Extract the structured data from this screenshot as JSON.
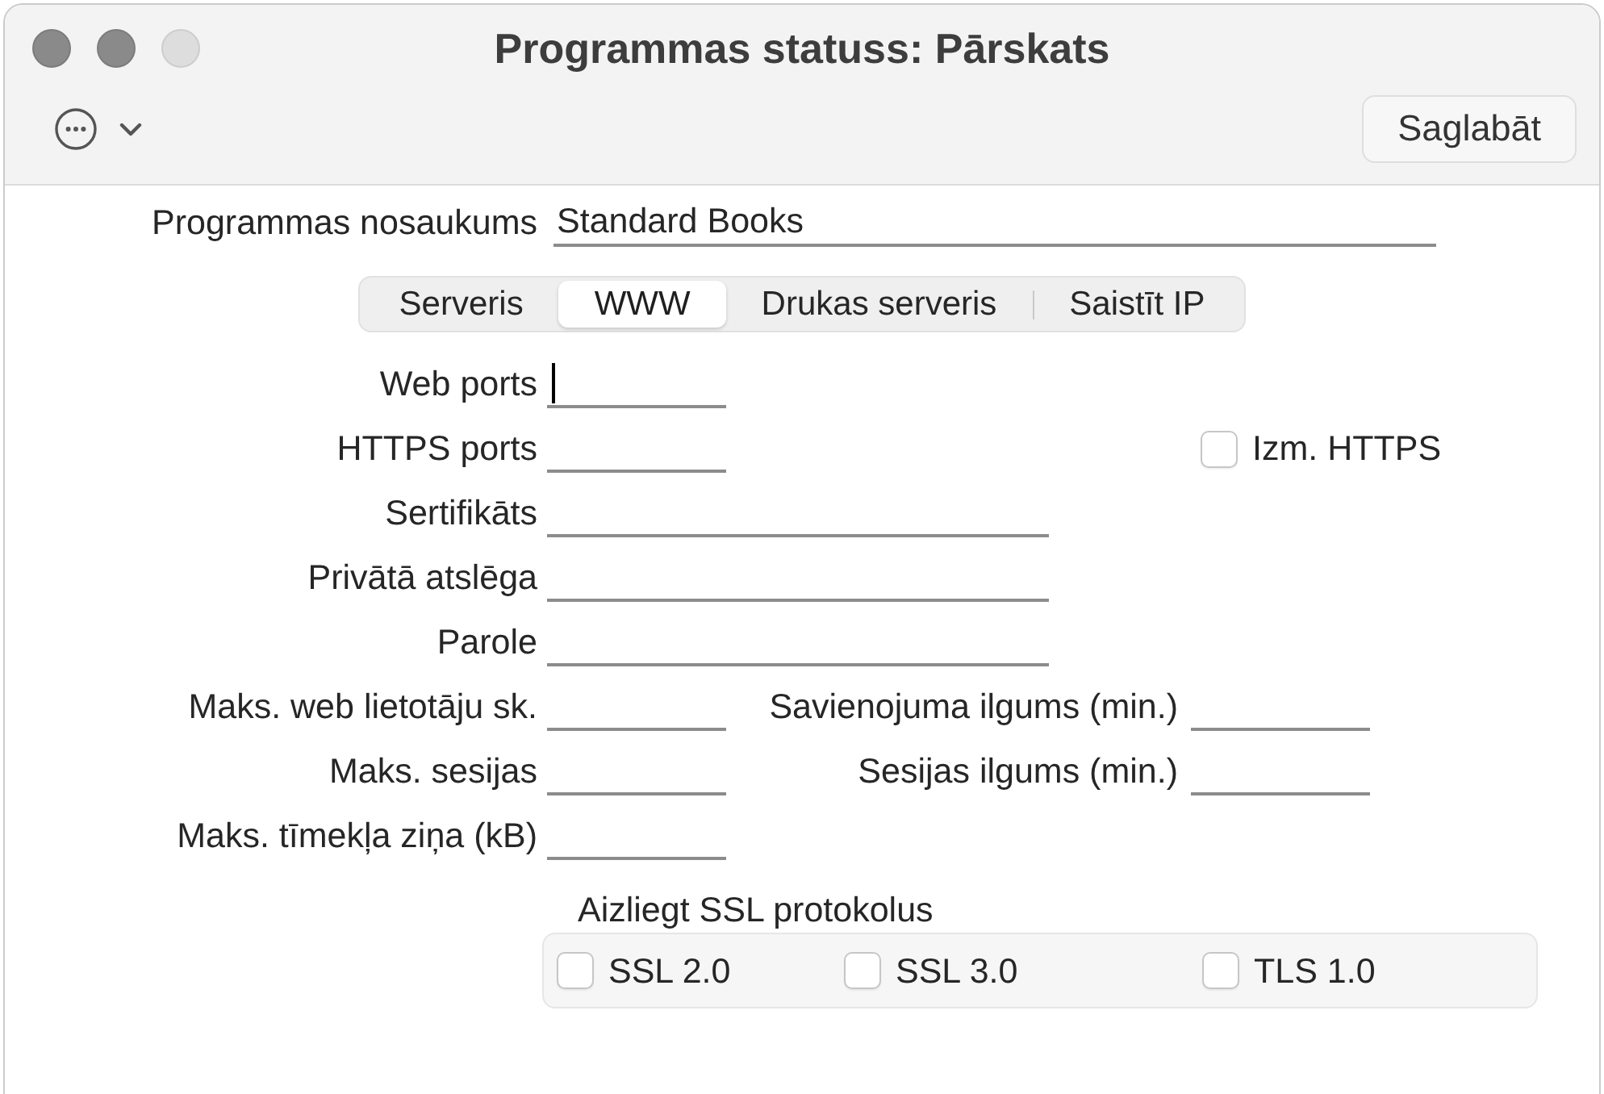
{
  "window": {
    "title": "Programmas statuss: Pārskats",
    "buttons": [
      {
        "disabled": false
      },
      {
        "disabled": false
      },
      {
        "disabled": true
      }
    ]
  },
  "toolbar": {
    "save_button": "Saglabāt"
  },
  "form": {
    "name_field": {
      "label": "Programmas nosaukums",
      "value": "Standard Books"
    },
    "tabs": [
      {
        "label": "Serveris",
        "selected": false
      },
      {
        "label": "WWW",
        "selected": true
      },
      {
        "label": "Drukas serveris",
        "selected": false
      },
      {
        "label": "Saistīt IP",
        "selected": false
      }
    ],
    "rows": [
      {
        "label": "Web ports",
        "input": {
          "kind": "number",
          "focused": true
        }
      },
      {
        "label": "HTTPS ports",
        "input": {
          "kind": "number",
          "focused": false
        },
        "checkbox": {
          "label": "Izm. HTTPS",
          "checked": false
        }
      },
      {
        "label": "Sertifikāts",
        "input": {
          "kind": "text",
          "focused": false
        }
      },
      {
        "label": "Privātā atslēga",
        "input": {
          "kind": "text",
          "focused": false
        }
      },
      {
        "label": "Parole",
        "input": {
          "kind": "text",
          "focused": false
        }
      },
      {
        "label": "Maks. web lietotāju sk.",
        "input": {
          "kind": "number",
          "focused": false
        },
        "pair": {
          "label": "Savienojuma ilgums (min.)",
          "input": {
            "kind": "number",
            "focused": false
          }
        }
      },
      {
        "label": "Maks. sesijas",
        "input": {
          "kind": "number",
          "focused": false
        },
        "pair": {
          "label": "Sesijas ilgums (min.)",
          "input": {
            "kind": "number",
            "focused": false
          }
        }
      },
      {
        "label": "Maks. tīmekļa ziņa (kB)",
        "input": {
          "kind": "number",
          "focused": false
        }
      }
    ]
  },
  "ssl_group": {
    "title": "Aizliegt SSL protokolus",
    "options": [
      {
        "label": "SSL 2.0",
        "checked": false
      },
      {
        "label": "SSL 3.0",
        "checked": false
      },
      {
        "label": "TLS 1.0",
        "checked": false
      }
    ]
  }
}
